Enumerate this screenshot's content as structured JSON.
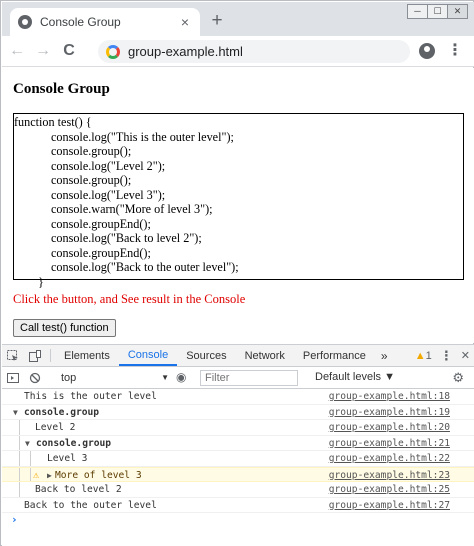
{
  "window": {
    "controls": [
      "─",
      "☐",
      "✕"
    ]
  },
  "tab": {
    "title": "Console Group",
    "close": "×",
    "new_tab": "+"
  },
  "toolbar": {
    "back": "←",
    "forward": "→",
    "reload": "C",
    "url": "group-example.html",
    "menu": "⋮"
  },
  "page": {
    "title": "Console Group",
    "code_lines": [
      "function test() {",
      "console.log(\"This is the outer level\");",
      "console.group();",
      "console.log(\"Level 2\");",
      "console.group();",
      "console.log(\"Level 3\");",
      "console.warn(\"More of level 3\");",
      "console.groupEnd();",
      "console.log(\"Back to level 2\");",
      "console.groupEnd();",
      "console.log(\"Back to the outer level\");",
      "}"
    ],
    "hint": "Click the button, and See result in the Console",
    "button_label": "Call test() function"
  },
  "devtools": {
    "tabs": [
      "Elements",
      "Console",
      "Sources",
      "Network",
      "Performance"
    ],
    "active_tab": "Console",
    "more": "»",
    "warning_count": "1",
    "menu": "⋮",
    "close": "✕",
    "context": "top",
    "context_arrow": "▼",
    "filter_placeholder": "Filter",
    "levels": "Default levels ▼"
  },
  "console": {
    "rows": [
      {
        "text": "This is the outer level",
        "source": "group-example.html:18"
      },
      {
        "text": "console.group",
        "source": "group-example.html:19"
      },
      {
        "text": "Level 2",
        "source": "group-example.html:20"
      },
      {
        "text": "console.group",
        "source": "group-example.html:21"
      },
      {
        "text": "Level 3",
        "source": "group-example.html:22"
      },
      {
        "text": "More of level 3",
        "source": "group-example.html:23"
      },
      {
        "text": "Back to level 2",
        "source": "group-example.html:25"
      },
      {
        "text": "Back to the outer level",
        "source": "group-example.html:27"
      }
    ],
    "prompt": "›"
  },
  "colors": {
    "accent": "#1a73e8",
    "hint_red": "#e00000",
    "warn_bg": "#fffbe5",
    "warn_icon": "#f2a900"
  }
}
